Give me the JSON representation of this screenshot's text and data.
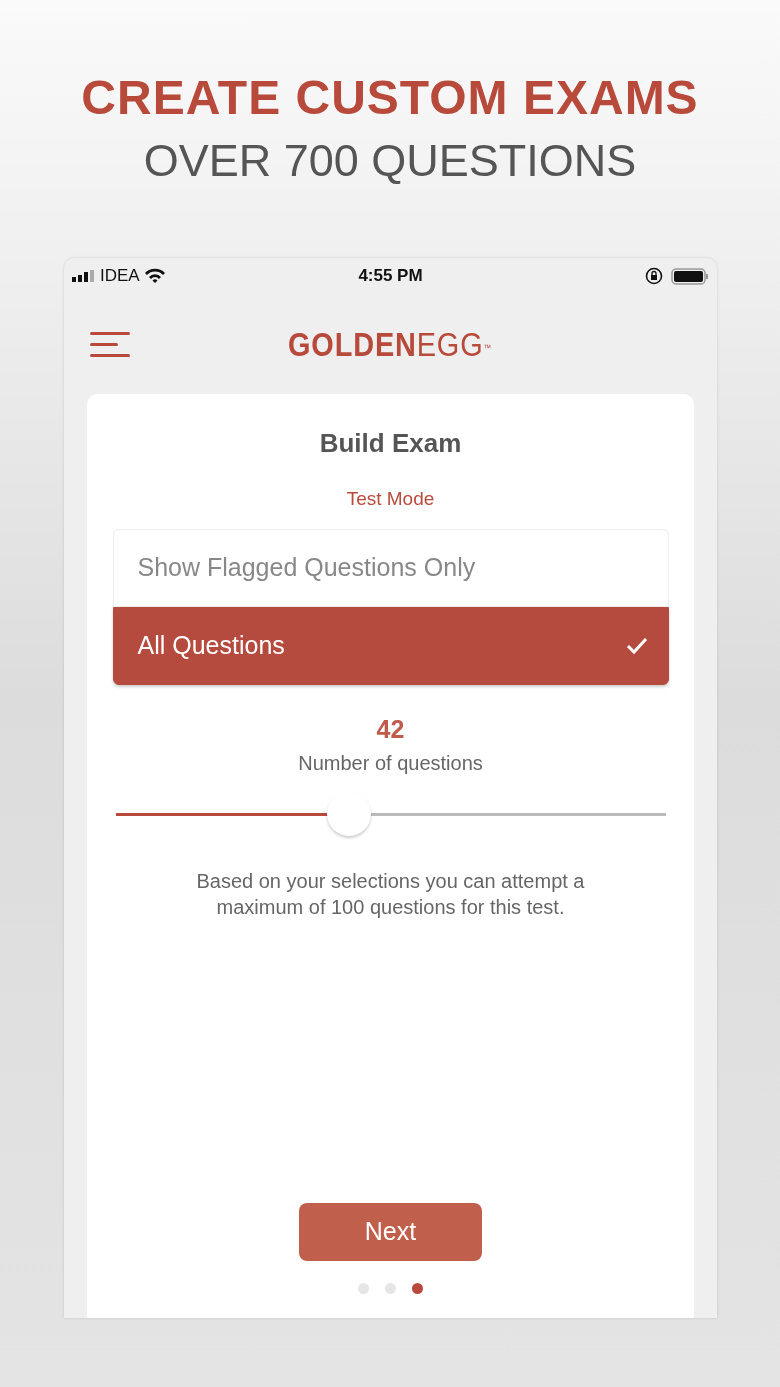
{
  "headline": {
    "title": "CREATE CUSTOM EXAMS",
    "subtitle": "OVER 700 QUESTIONS"
  },
  "status_bar": {
    "carrier": "IDEA",
    "time": "4:55 PM"
  },
  "logo": {
    "strong": "GOLDEN",
    "light": "EGG",
    "mark": "™"
  },
  "card": {
    "title": "Build Exam",
    "section_label": "Test Mode",
    "options": [
      {
        "label": "Show Flagged Questions Only",
        "selected": false
      },
      {
        "label": "All Questions",
        "selected": true
      }
    ],
    "count": "42",
    "count_label": "Number of questions",
    "slider": {
      "level": 0.425
    },
    "note": "Based on your selections you can attempt a maximum of 100 questions for this test.",
    "next_button": "Next",
    "pages": [
      {
        "selected": false
      },
      {
        "selected": false
      },
      {
        "selected": true
      }
    ]
  }
}
